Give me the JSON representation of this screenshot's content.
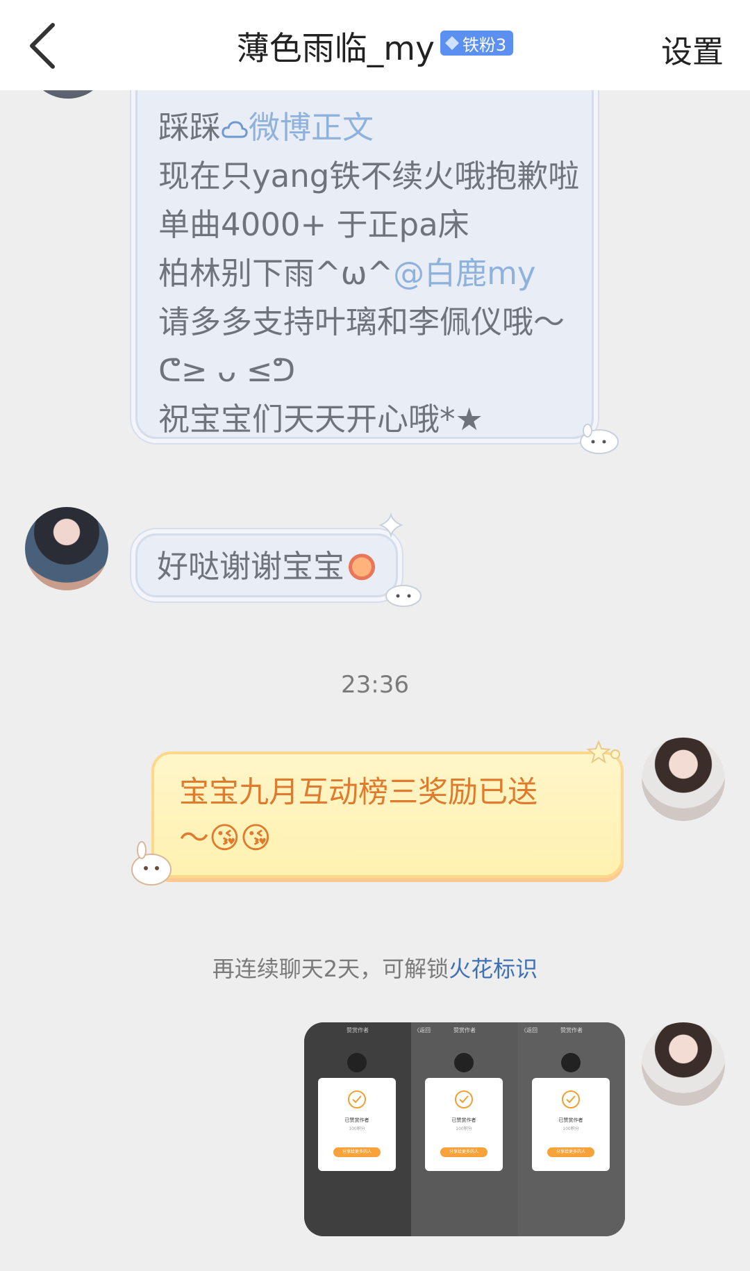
{
  "header": {
    "title": "薄色雨临_my",
    "badge": "铁粉3",
    "settings": "设置"
  },
  "messages": {
    "first_bubble_lines": [
      {
        "text": "踩踩",
        "link": "微博正文"
      },
      {
        "text": "现在只yang铁不续火哦抱歉啦"
      },
      {
        "text": "单曲4000+ 于正pa床"
      },
      {
        "text": "柏林别下雨^ω^",
        "link": "@白鹿my"
      },
      {
        "text": "请多多支持叶璃和李佩仪哦～"
      },
      {
        "text": "ᕦ≥ ᴗ ≤ᕤ"
      },
      {
        "text": "祝宝宝们天天开心哦*★"
      }
    ],
    "second_bubble": "好哒谢谢宝宝",
    "timestamp": "23:36",
    "yellow_line1": "宝宝九月互动榜三奖励已送",
    "yellow_line2": "～😘😘",
    "system_prefix": "再连续聊天2天，可解锁",
    "system_link": "火花标识"
  },
  "screenshot_card": {
    "panels": [
      {
        "title": "赞赏作者",
        "nav": "",
        "modal_title": "已赞赏作者",
        "modal_sub": "100积分",
        "modal_btn": "分享给更多的人"
      },
      {
        "title": "赞赏作者",
        "nav": "〈返回",
        "modal_title": "已赞赏作者",
        "modal_sub": "100积分",
        "modal_btn": "分享给更多的人"
      },
      {
        "title": "赞赏作者",
        "nav": "〈返回",
        "modal_title": "已赞赏作者",
        "modal_sub": "100积分",
        "modal_btn": "分享给更多的人"
      }
    ]
  },
  "colors": {
    "badge": "#5b8ff0",
    "link_blue": "#8fb2dd",
    "yellow_text": "#e07a2c",
    "system_link": "#3f6fb5"
  }
}
